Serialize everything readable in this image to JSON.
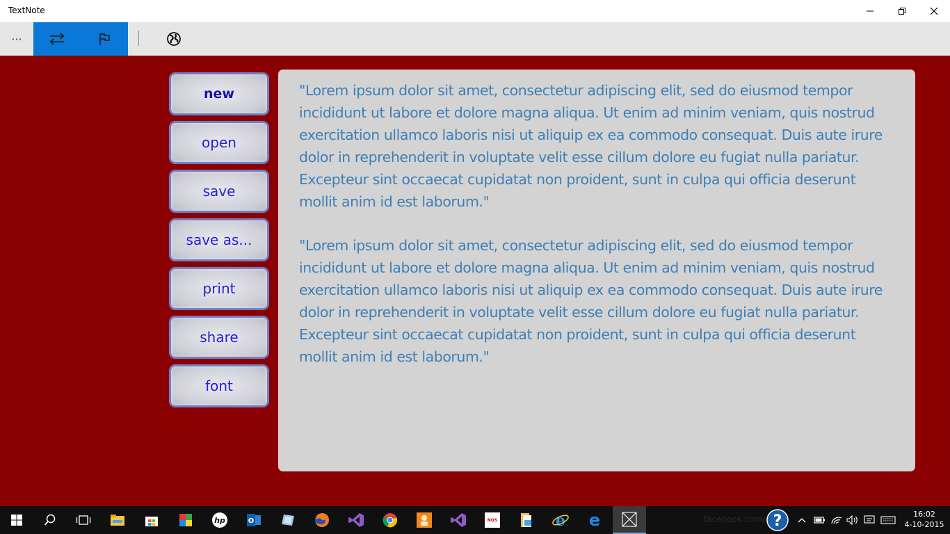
{
  "window": {
    "title": "TextNote",
    "minimize_icon": "minimize-icon",
    "maximize_icon": "restore-icon",
    "close_icon": "close-icon"
  },
  "appbar": {
    "more_label": "···",
    "icons": [
      "swap-arrows-icon",
      "flag-icon",
      "globe-icon"
    ],
    "accent": "#0a78d7"
  },
  "sidebar": {
    "buttons": [
      {
        "label": "new"
      },
      {
        "label": "open"
      },
      {
        "label": "save"
      },
      {
        "label": "save as..."
      },
      {
        "label": "print"
      },
      {
        "label": "share"
      },
      {
        "label": "font"
      }
    ]
  },
  "editor": {
    "paragraphs": [
      "\"Lorem ipsum dolor sit amet, consectetur adipiscing elit, sed do eiusmod tempor incididunt ut labore et dolore magna aliqua. Ut enim ad minim veniam, quis nostrud exercitation ullamco laboris nisi ut aliquip ex ea commodo consequat. Duis aute irure dolor in reprehenderit in voluptate velit esse cillum dolore eu fugiat nulla pariatur. Excepteur sint occaecat cupidatat non proident, sunt in culpa qui officia deserunt mollit anim id est laborum.\"",
      "\"Lorem ipsum dolor sit amet, consectetur adipiscing elit, sed do eiusmod tempor incididunt ut labore et dolore magna aliqua. Ut enim ad minim veniam, quis nostrud exercitation ullamco laboris nisi ut aliquip ex ea commodo consequat. Duis aute irure dolor in reprehenderit in voluptate velit esse cillum dolore eu fugiat nulla pariatur. Excepteur sint occaecat cupidatat non proident, sunt in culpa qui officia deserunt mollit anim id est laborum.\""
    ],
    "text_color": "#3e7fb6",
    "background": "#d3d3d3"
  },
  "colors": {
    "background": "#8b0000",
    "button_text": "#2323d6",
    "button_border": "#6f7fc4"
  },
  "taskbar": {
    "apps": [
      "start-icon",
      "search-icon",
      "task-view-icon",
      "file-explorer-icon",
      "store-icon",
      "paint-icon",
      "hp-icon",
      "outlook-icon",
      "app-icon",
      "firefox-icon",
      "visual-studio-icon",
      "chrome-icon",
      "app-icon",
      "visual-studio-icon",
      "nos-icon",
      "explorer-icon",
      "internet-explorer-icon",
      "edge-icon",
      "textnote-icon"
    ],
    "ghost_text": "facebook.com/...",
    "time": "16:02",
    "date": "4-10-2015"
  }
}
